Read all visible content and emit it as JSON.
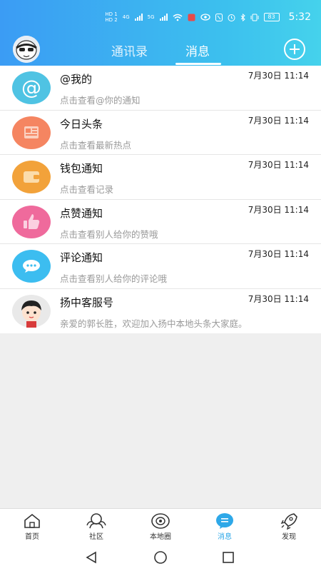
{
  "statusbar": {
    "hd1": "HD 1",
    "hd2": "HD 2",
    "net1": "4G",
    "net2": "5G",
    "battery": "83",
    "time": "5:32"
  },
  "header": {
    "tabs": [
      {
        "label": "通讯录",
        "active": false
      },
      {
        "label": "消息",
        "active": true
      }
    ]
  },
  "messages": [
    {
      "title": "@我的",
      "subtitle": "点击查看@你的通知",
      "time": "7月30日 11:14",
      "icon": "at-icon",
      "color": "#4fc3e3"
    },
    {
      "title": "今日头条",
      "subtitle": "点击查看最新热点",
      "time": "7月30日 11:14",
      "icon": "newspaper-icon",
      "color": "#f58561"
    },
    {
      "title": "钱包通知",
      "subtitle": "点击查看记录",
      "time": "7月30日 11:14",
      "icon": "wallet-icon",
      "color": "#f2a23a"
    },
    {
      "title": "点赞通知",
      "subtitle": "点击查看别人给你的赞哦",
      "time": "7月30日 11:14",
      "icon": "thumbs-up-icon",
      "color": "#ef6a9c"
    },
    {
      "title": "评论通知",
      "subtitle": "点击查看别人给你的评论哦",
      "time": "7月30日 11:14",
      "icon": "comment-icon",
      "color": "#3cbdf0"
    },
    {
      "title": "扬中客服号",
      "subtitle": "亲爱的郭长胜，欢迎加入扬中本地头条大家庭。",
      "time": "7月30日 11:14",
      "icon": "service-avatar",
      "color": "#f5f5f5"
    }
  ],
  "bottomnav": [
    {
      "label": "首页",
      "icon": "home-icon",
      "active": false
    },
    {
      "label": "社区",
      "icon": "community-icon",
      "active": false
    },
    {
      "label": "本地圈",
      "icon": "local-circle-icon",
      "active": false
    },
    {
      "label": "消息",
      "icon": "message-icon",
      "active": true
    },
    {
      "label": "发现",
      "icon": "rocket-icon",
      "active": false
    }
  ],
  "colors": {
    "header_start": "#3b9cf4",
    "header_end": "#45d2ec",
    "active_nav": "#2ea8e8"
  }
}
